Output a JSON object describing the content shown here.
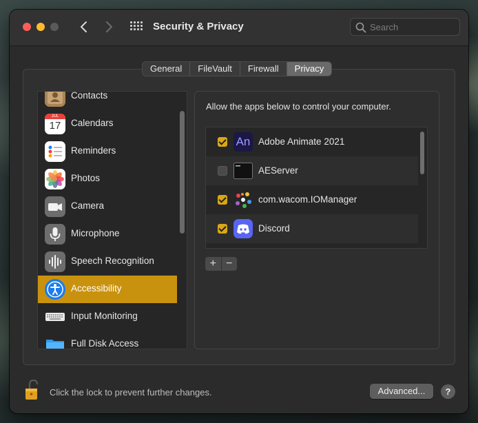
{
  "window": {
    "title": "Security & Privacy"
  },
  "search": {
    "placeholder": "Search"
  },
  "tabs": [
    {
      "label": "General",
      "active": false
    },
    {
      "label": "FileVault",
      "active": false
    },
    {
      "label": "Firewall",
      "active": false
    },
    {
      "label": "Privacy",
      "active": true
    }
  ],
  "sidebar": {
    "items": [
      {
        "label": "Contacts",
        "icon": "contacts-icon",
        "selected": false
      },
      {
        "label": "Calendars",
        "icon": "calendar-icon",
        "calendar_month": "JUL",
        "calendar_day": "17",
        "selected": false
      },
      {
        "label": "Reminders",
        "icon": "reminders-icon",
        "selected": false
      },
      {
        "label": "Photos",
        "icon": "photos-icon",
        "selected": false
      },
      {
        "label": "Camera",
        "icon": "camera-icon",
        "selected": false
      },
      {
        "label": "Microphone",
        "icon": "microphone-icon",
        "selected": false
      },
      {
        "label": "Speech Recognition",
        "icon": "speech-recognition-icon",
        "selected": false
      },
      {
        "label": "Accessibility",
        "icon": "accessibility-icon",
        "selected": true
      },
      {
        "label": "Input Monitoring",
        "icon": "keyboard-icon",
        "selected": false
      },
      {
        "label": "Full Disk Access",
        "icon": "folder-icon",
        "selected": false
      }
    ]
  },
  "main": {
    "instruction": "Allow the apps below to control your computer.",
    "apps": [
      {
        "name": "Adobe Animate 2021",
        "checked": true,
        "icon": "adobe-animate-icon",
        "icon_text": "An"
      },
      {
        "name": "AEServer",
        "checked": false,
        "icon": "terminal-icon"
      },
      {
        "name": "com.wacom.IOManager",
        "checked": true,
        "icon": "wacom-icon"
      },
      {
        "name": "Discord",
        "checked": true,
        "icon": "discord-icon"
      }
    ],
    "add_label": "+",
    "remove_label": "−"
  },
  "footer": {
    "lock_text": "Click the lock to prevent further changes.",
    "advanced_label": "Advanced...",
    "help_label": "?"
  },
  "colors": {
    "selection": "#c9920e",
    "checkbox_on": "#d9a715"
  }
}
